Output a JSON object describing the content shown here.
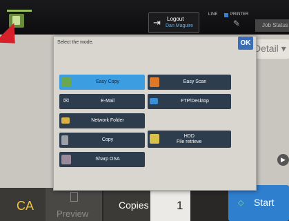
{
  "topbar": {
    "logout_label": "Logout",
    "user_name": "Dan Maguire",
    "line_label": "LINE",
    "printer_label": "PRINTER",
    "job_status_label": "Job Status"
  },
  "main": {
    "detail_label": "Detail"
  },
  "dialog": {
    "title": "Select the mode.",
    "ok_label": "OK",
    "modes": [
      {
        "label": "Easy Copy",
        "icon": "copy-icon",
        "color": "#6aa84f"
      },
      {
        "label": "Easy Scan",
        "icon": "scan-icon",
        "color": "#e0782a"
      },
      {
        "label": "E-Mail",
        "icon": "email-icon",
        "color": "#e0e0e0"
      },
      {
        "label": "FTP/Desktop",
        "icon": "desktop-icon",
        "color": "#3a8fd6"
      },
      {
        "label": "Network Folder",
        "icon": "folder-icon",
        "color": "#d8b04a"
      },
      {
        "label": "Copy",
        "icon": "copy-icon",
        "color": "#9aa0a6"
      },
      {
        "label": "HDD\nFile retrieve",
        "icon": "hdd-icon",
        "color": "#d8c04a"
      },
      {
        "label": "Sharp OSA",
        "icon": "osa-icon",
        "color": "#9a8a9a"
      }
    ]
  },
  "bottombar": {
    "ca_label": "CA",
    "preview_label": "Preview",
    "copies_label": "Copies",
    "copies_value": "1",
    "start_label": "Start"
  },
  "colors": {
    "selected_mode": "#3c9ee0",
    "mode_button": "#2e3d4e",
    "start_button": "#2f7fcf",
    "ca_text": "#f2c238"
  }
}
